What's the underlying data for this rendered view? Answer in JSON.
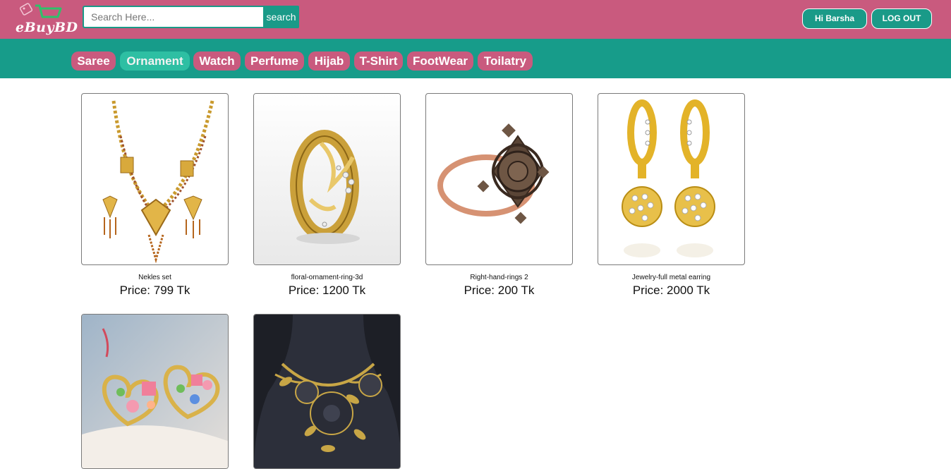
{
  "header": {
    "logo_text": "eBuyBD",
    "search": {
      "placeholder": "Search Here...",
      "value": "",
      "button_label": "search"
    },
    "greeting_button": "Hi Barsha",
    "logout_button": "LOG OUT",
    "colors": {
      "header_bg": "#c95a7e",
      "accent": "#1a9a88"
    }
  },
  "nav": {
    "items": [
      {
        "label": "Saree",
        "active": false
      },
      {
        "label": "Ornament",
        "active": true
      },
      {
        "label": "Watch",
        "active": false
      },
      {
        "label": "Perfume",
        "active": false
      },
      {
        "label": "Hijab",
        "active": false
      },
      {
        "label": "T-Shirt",
        "active": false
      },
      {
        "label": "FootWear",
        "active": false
      },
      {
        "label": "Toilatry",
        "active": false
      }
    ]
  },
  "products": [
    {
      "name": "Nekles set",
      "price": "Price: 799 Tk",
      "image": "gold-necklace-set-image"
    },
    {
      "name": "floral-ornament-ring-3d",
      "price": "Price: 1200 Tk",
      "image": "floral-gold-ring-image"
    },
    {
      "name": "Right-hand-rings 2",
      "price": "Price: 200 Tk",
      "image": "rose-gold-ring-image"
    },
    {
      "name": "Jewelry-full metal earring",
      "price": "Price: 2000 Tk",
      "image": "gold-drop-earrings-image"
    },
    {
      "name": "",
      "price": "",
      "image": "heart-earrings-image"
    },
    {
      "name": "",
      "price": "",
      "image": "floral-bib-necklace-image"
    }
  ]
}
